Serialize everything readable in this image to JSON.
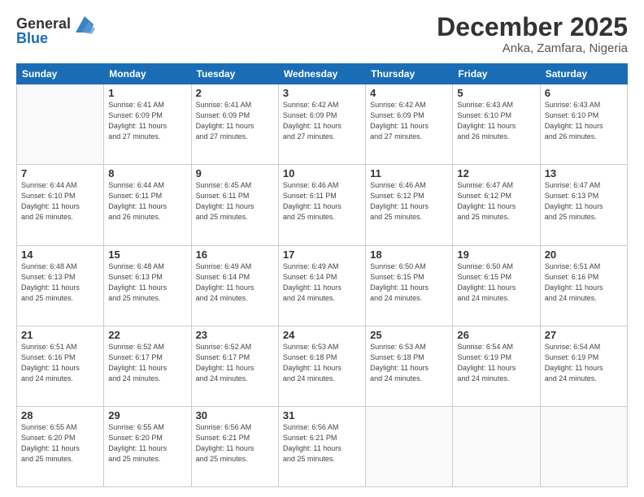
{
  "logo": {
    "text_general": "General",
    "text_blue": "Blue"
  },
  "title": "December 2025",
  "subtitle": "Anka, Zamfara, Nigeria",
  "days_header": [
    "Sunday",
    "Monday",
    "Tuesday",
    "Wednesday",
    "Thursday",
    "Friday",
    "Saturday"
  ],
  "weeks": [
    [
      {
        "num": "",
        "info": ""
      },
      {
        "num": "1",
        "info": "Sunrise: 6:41 AM\nSunset: 6:09 PM\nDaylight: 11 hours\nand 27 minutes."
      },
      {
        "num": "2",
        "info": "Sunrise: 6:41 AM\nSunset: 6:09 PM\nDaylight: 11 hours\nand 27 minutes."
      },
      {
        "num": "3",
        "info": "Sunrise: 6:42 AM\nSunset: 6:09 PM\nDaylight: 11 hours\nand 27 minutes."
      },
      {
        "num": "4",
        "info": "Sunrise: 6:42 AM\nSunset: 6:09 PM\nDaylight: 11 hours\nand 27 minutes."
      },
      {
        "num": "5",
        "info": "Sunrise: 6:43 AM\nSunset: 6:10 PM\nDaylight: 11 hours\nand 26 minutes."
      },
      {
        "num": "6",
        "info": "Sunrise: 6:43 AM\nSunset: 6:10 PM\nDaylight: 11 hours\nand 26 minutes."
      }
    ],
    [
      {
        "num": "7",
        "info": "Sunrise: 6:44 AM\nSunset: 6:10 PM\nDaylight: 11 hours\nand 26 minutes."
      },
      {
        "num": "8",
        "info": "Sunrise: 6:44 AM\nSunset: 6:11 PM\nDaylight: 11 hours\nand 26 minutes."
      },
      {
        "num": "9",
        "info": "Sunrise: 6:45 AM\nSunset: 6:11 PM\nDaylight: 11 hours\nand 25 minutes."
      },
      {
        "num": "10",
        "info": "Sunrise: 6:46 AM\nSunset: 6:11 PM\nDaylight: 11 hours\nand 25 minutes."
      },
      {
        "num": "11",
        "info": "Sunrise: 6:46 AM\nSunset: 6:12 PM\nDaylight: 11 hours\nand 25 minutes."
      },
      {
        "num": "12",
        "info": "Sunrise: 6:47 AM\nSunset: 6:12 PM\nDaylight: 11 hours\nand 25 minutes."
      },
      {
        "num": "13",
        "info": "Sunrise: 6:47 AM\nSunset: 6:13 PM\nDaylight: 11 hours\nand 25 minutes."
      }
    ],
    [
      {
        "num": "14",
        "info": "Sunrise: 6:48 AM\nSunset: 6:13 PM\nDaylight: 11 hours\nand 25 minutes."
      },
      {
        "num": "15",
        "info": "Sunrise: 6:48 AM\nSunset: 6:13 PM\nDaylight: 11 hours\nand 25 minutes."
      },
      {
        "num": "16",
        "info": "Sunrise: 6:49 AM\nSunset: 6:14 PM\nDaylight: 11 hours\nand 24 minutes."
      },
      {
        "num": "17",
        "info": "Sunrise: 6:49 AM\nSunset: 6:14 PM\nDaylight: 11 hours\nand 24 minutes."
      },
      {
        "num": "18",
        "info": "Sunrise: 6:50 AM\nSunset: 6:15 PM\nDaylight: 11 hours\nand 24 minutes."
      },
      {
        "num": "19",
        "info": "Sunrise: 6:50 AM\nSunset: 6:15 PM\nDaylight: 11 hours\nand 24 minutes."
      },
      {
        "num": "20",
        "info": "Sunrise: 6:51 AM\nSunset: 6:16 PM\nDaylight: 11 hours\nand 24 minutes."
      }
    ],
    [
      {
        "num": "21",
        "info": "Sunrise: 6:51 AM\nSunset: 6:16 PM\nDaylight: 11 hours\nand 24 minutes."
      },
      {
        "num": "22",
        "info": "Sunrise: 6:52 AM\nSunset: 6:17 PM\nDaylight: 11 hours\nand 24 minutes."
      },
      {
        "num": "23",
        "info": "Sunrise: 6:52 AM\nSunset: 6:17 PM\nDaylight: 11 hours\nand 24 minutes."
      },
      {
        "num": "24",
        "info": "Sunrise: 6:53 AM\nSunset: 6:18 PM\nDaylight: 11 hours\nand 24 minutes."
      },
      {
        "num": "25",
        "info": "Sunrise: 6:53 AM\nSunset: 6:18 PM\nDaylight: 11 hours\nand 24 minutes."
      },
      {
        "num": "26",
        "info": "Sunrise: 6:54 AM\nSunset: 6:19 PM\nDaylight: 11 hours\nand 24 minutes."
      },
      {
        "num": "27",
        "info": "Sunrise: 6:54 AM\nSunset: 6:19 PM\nDaylight: 11 hours\nand 24 minutes."
      }
    ],
    [
      {
        "num": "28",
        "info": "Sunrise: 6:55 AM\nSunset: 6:20 PM\nDaylight: 11 hours\nand 25 minutes."
      },
      {
        "num": "29",
        "info": "Sunrise: 6:55 AM\nSunset: 6:20 PM\nDaylight: 11 hours\nand 25 minutes."
      },
      {
        "num": "30",
        "info": "Sunrise: 6:56 AM\nSunset: 6:21 PM\nDaylight: 11 hours\nand 25 minutes."
      },
      {
        "num": "31",
        "info": "Sunrise: 6:56 AM\nSunset: 6:21 PM\nDaylight: 11 hours\nand 25 minutes."
      },
      {
        "num": "",
        "info": ""
      },
      {
        "num": "",
        "info": ""
      },
      {
        "num": "",
        "info": ""
      }
    ]
  ]
}
